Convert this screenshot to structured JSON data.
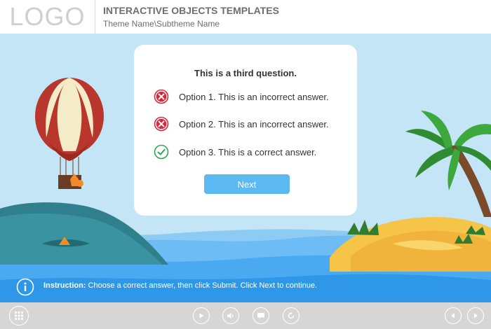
{
  "header": {
    "logo": "LOGO",
    "title": "INTERACTIVE OBJECTS TEMPLATES",
    "subtitle": "Theme Name\\Subtheme Name"
  },
  "quiz": {
    "question": "This is a third question.",
    "options": [
      {
        "label": "Option 1. This is an incorrect answer.",
        "status": "incorrect"
      },
      {
        "label": "Option 2. This is an incorrect answer.",
        "status": "incorrect"
      },
      {
        "label": "Option 3. This is a correct answer.",
        "status": "correct"
      }
    ],
    "next_label": "Next"
  },
  "instruction": {
    "prefix": "Instruction:",
    "text": " Choose a correct answer, then click Submit. Click Next to continue."
  },
  "controls": {
    "left": [
      "menu-icon"
    ],
    "center": [
      "play-icon",
      "volume-icon",
      "subtitles-icon",
      "replay-icon"
    ],
    "right": [
      "prev-icon",
      "next-icon"
    ]
  },
  "colors": {
    "incorrect": "#d8273a",
    "correct": "#2aa952",
    "button": "#5cb9f2",
    "sky": "#c4e5f6",
    "sea": "#4aaaf1",
    "bar": "#d6d6d6"
  }
}
